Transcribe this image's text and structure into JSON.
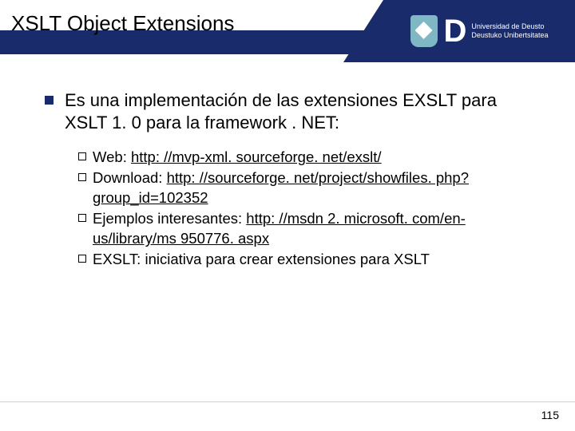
{
  "title": "XSLT Object Extensions",
  "logo": {
    "line1": "Universidad de Deusto",
    "line2": "Deustuko Unibertsitatea"
  },
  "main_bullet": "Es una implementación de las extensiones EXSLT para XSLT 1. 0 para la framework . NET:",
  "subs": [
    {
      "prefix": "Web: ",
      "link": "http: //mvp-xml. sourceforge. net/exslt/",
      "suffix": ""
    },
    {
      "prefix": "Download: ",
      "link": "http: //sourceforge. net/project/showfiles. php? group_id=102352",
      "suffix": ""
    },
    {
      "prefix": "Ejemplos interesantes: ",
      "link": "http: //msdn 2. microsoft. com/en-us/library/ms 950776. aspx",
      "suffix": ""
    },
    {
      "prefix": "EXSLT: iniciativa para crear extensiones para XSLT",
      "link": "",
      "suffix": ""
    }
  ],
  "page_number": "115"
}
